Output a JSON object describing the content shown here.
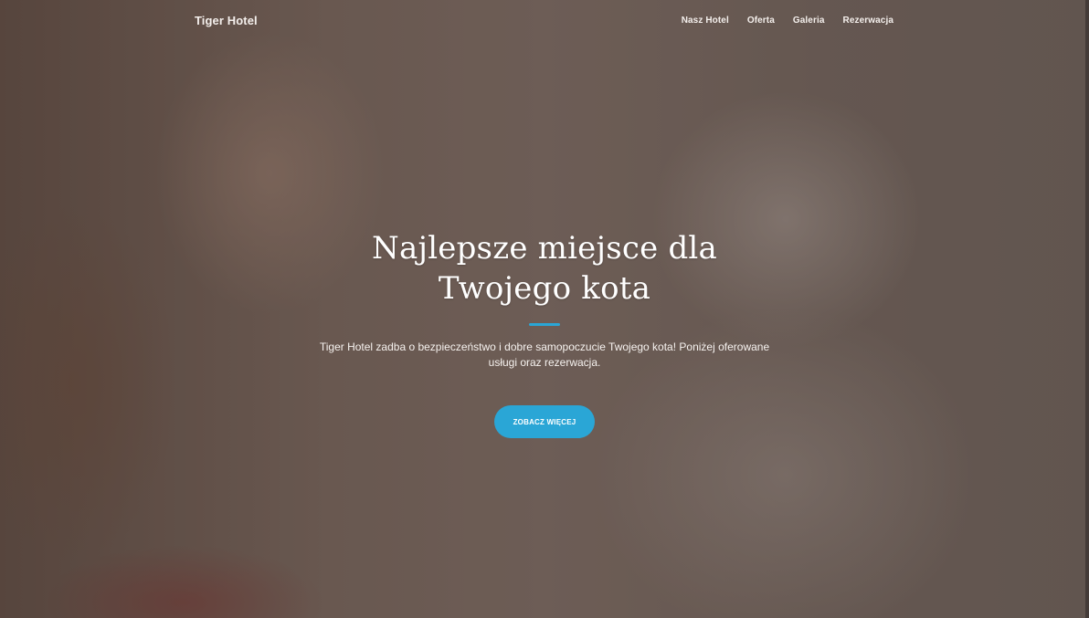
{
  "header": {
    "brand": "Tiger Hotel",
    "nav": [
      "Nasz Hotel",
      "Oferta",
      "Galeria",
      "Rezerwacja"
    ]
  },
  "hero": {
    "title_line1": "Najlepsze miejsce dla",
    "title_line2": "Twojego kota",
    "subtitle": "Tiger Hotel zadba o bezpieczeństwo i dobre samopoczucie Twojego kota! Poniżej oferowane usługi oraz rezerwacja.",
    "cta_label": "ZOBACZ WIĘCEJ",
    "accent_color": "#2aa6d6"
  }
}
